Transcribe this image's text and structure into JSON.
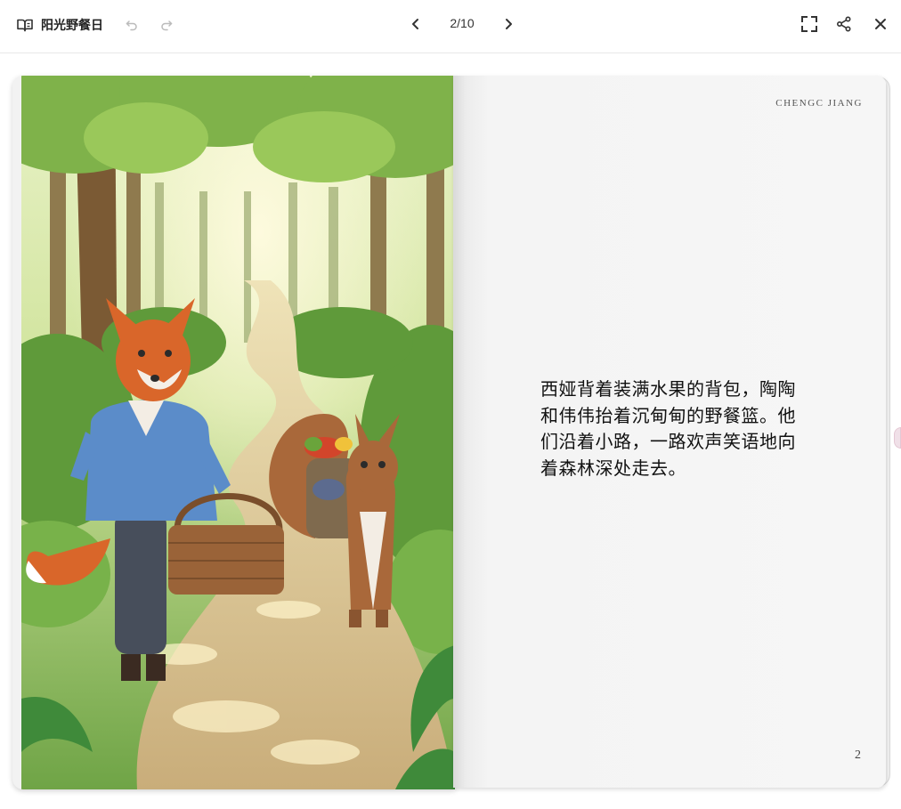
{
  "toolbar": {
    "title": "阳光野餐日",
    "page_indicator": "2/10",
    "icons": {
      "book": "book-icon",
      "undo": "undo-icon",
      "redo": "redo-icon",
      "prev": "chevron-left-icon",
      "next": "chevron-right-icon",
      "fullscreen": "fullscreen-icon",
      "share": "share-icon",
      "close": "close-icon"
    }
  },
  "book": {
    "current_page": 2,
    "total_pages": 10,
    "right_page": {
      "author": "CHENGC JIANG",
      "text": "西娅背着装满水果的背包，陶陶和伟伟抬着沉甸甸的野餐篮。他们沿着小路，一路欢声笑语地向着森林深处走去。",
      "page_number": "2"
    }
  },
  "colors": {
    "toolbar_bg": "#ffffff",
    "icon": "#333333",
    "icon_disabled": "#bbbbbb",
    "page_bg": "#f6f6f6"
  }
}
